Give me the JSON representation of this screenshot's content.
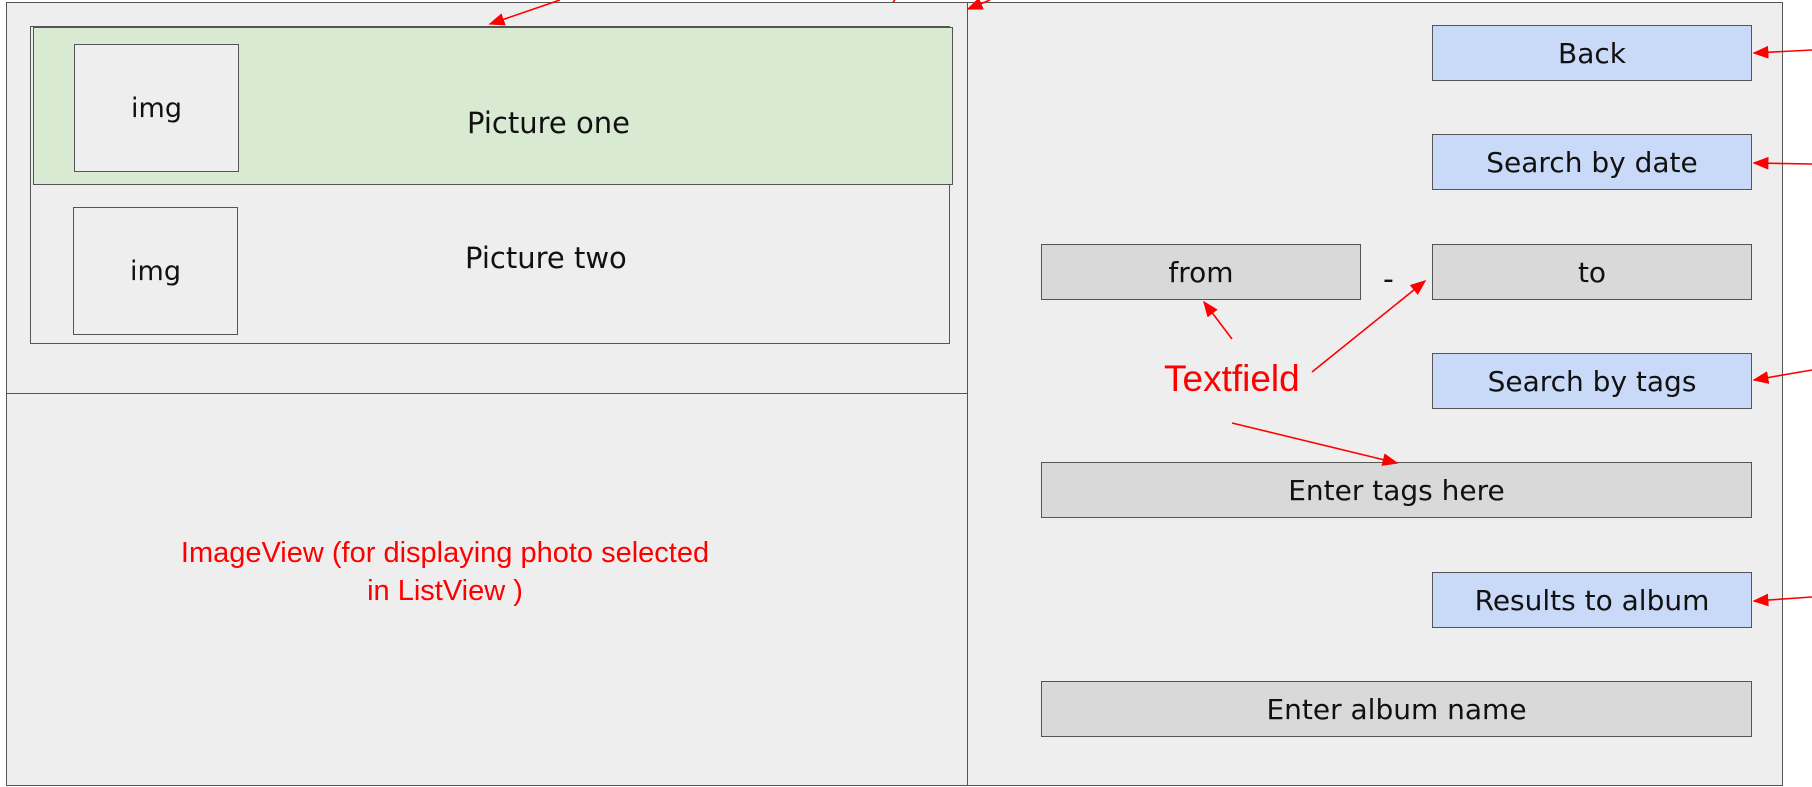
{
  "list_view": {
    "items": [
      {
        "thumb": "img",
        "label": "Picture one"
      },
      {
        "thumb": "img",
        "label": "Picture two"
      }
    ]
  },
  "image_view": {
    "note_line1": "ImageView (for displaying photo selected",
    "note_line2": "in ListView )"
  },
  "controls": {
    "back_label": "Back",
    "search_date_label": "Search by date",
    "from_value": "from",
    "dash": "-",
    "to_value": "to",
    "search_tags_label": "Search by tags",
    "tags_value": "Enter tags here",
    "results_label": "Results to album",
    "album_value": "Enter album name"
  },
  "annotations": {
    "textfield_label": "Textfield",
    "color": "#ff0000"
  },
  "colors": {
    "selected_row": "#d9ead3",
    "button": "#c9daf8",
    "field": "#d9d9d9",
    "background": "#eeeeee"
  }
}
